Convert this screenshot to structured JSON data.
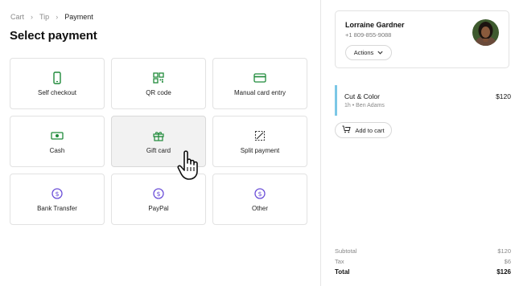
{
  "breadcrumb": {
    "items": [
      "Cart",
      "Tip",
      "Payment"
    ],
    "separator": "›"
  },
  "page_title": "Select payment",
  "payment_methods": [
    {
      "label": "Self checkout",
      "icon": "phone-icon",
      "selected": false
    },
    {
      "label": "QR code",
      "icon": "qr-code-icon",
      "selected": false
    },
    {
      "label": "Manual card entry",
      "icon": "credit-card-icon",
      "selected": false
    },
    {
      "label": "Cash",
      "icon": "cash-icon",
      "selected": false
    },
    {
      "label": "Gift card",
      "icon": "gift-icon",
      "selected": true
    },
    {
      "label": "Split payment",
      "icon": "split-icon",
      "selected": false
    },
    {
      "label": "Bank Transfer",
      "icon": "dollar-circle-icon",
      "selected": false
    },
    {
      "label": "PayPal",
      "icon": "dollar-circle-icon",
      "selected": false
    },
    {
      "label": "Other",
      "icon": "dollar-circle-icon",
      "selected": false
    }
  ],
  "customer": {
    "name": "Lorraine Gardner",
    "phone": "+1 809-855-9088",
    "actions_label": "Actions"
  },
  "cart_item": {
    "name": "Cut & Color",
    "details": "1h • Ben Adams",
    "price": "$120"
  },
  "add_to_cart_label": "Add to cart",
  "totals": {
    "subtotal_label": "Subtotal",
    "subtotal_value": "$120",
    "tax_label": "Tax",
    "tax_value": "$6",
    "total_label": "Total",
    "total_value": "$126"
  },
  "colors": {
    "icon_green": "#1f8a3a",
    "icon_purple": "#6b4fd8",
    "service_accent": "#7cc7e6"
  }
}
